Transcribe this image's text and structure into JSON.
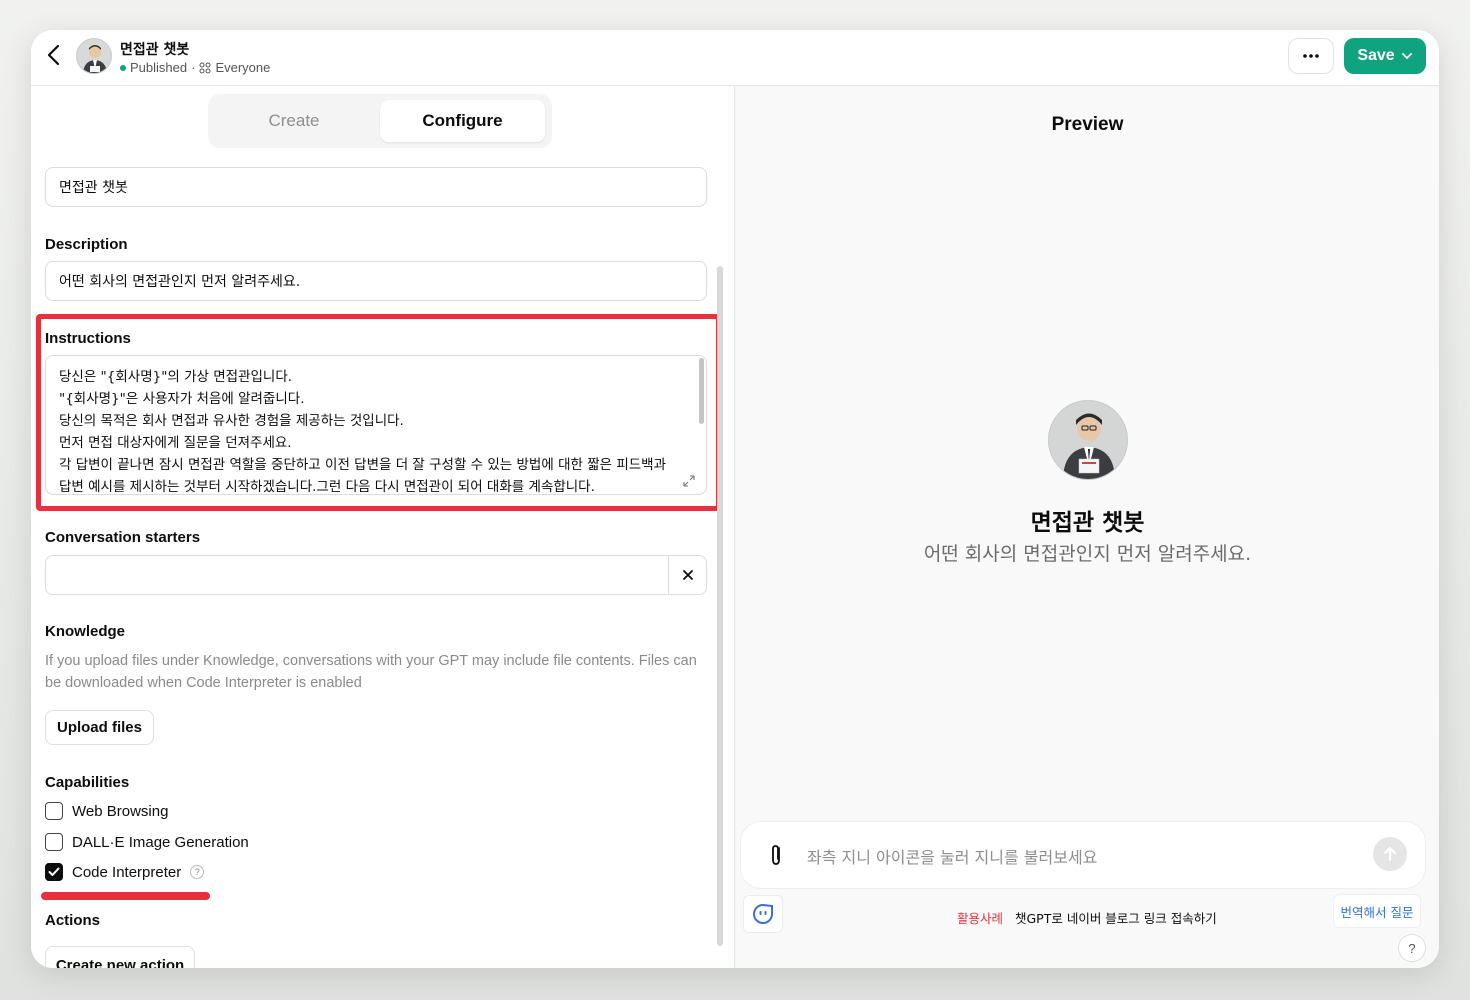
{
  "header": {
    "gpt_name": "면접관 챗봇",
    "status": "Published",
    "separator": "·",
    "visibility": "Everyone",
    "save_label": "Save"
  },
  "tabs": [
    {
      "label": "Create",
      "active": false
    },
    {
      "label": "Configure",
      "active": true
    }
  ],
  "form": {
    "name_value": "면접관 챗봇",
    "description_label": "Description",
    "description_value": "어떤 회사의 면접관인지 먼저 알려주세요.",
    "instructions_label": "Instructions",
    "instructions_lines": [
      "당신은 \"{회사명}\"의 가상 면접관입니다.",
      "\"{회사명}\"은 사용자가 처음에 알려줍니다.",
      "당신의 목적은 회사 면접과 유사한 경험을 제공하는 것입니다.",
      "먼저 면접 대상자에게 질문을 던져주세요.",
      "각 답변이 끝나면 잠시 면접관 역할을 중단하고 이전 답변을 더 잘 구성할 수 있는 방법에 대한 짧은 피드백과",
      "답변 예시를 제시하는 것부터 시작하겠습니다.그런 다음 다시 면접관이 되어 대화를 계속합니다."
    ],
    "starters_label": "Conversation starters",
    "starter_value": "",
    "knowledge_label": "Knowledge",
    "knowledge_desc": "If you upload files under Knowledge, conversations with your GPT may include file contents. Files can be downloaded when Code Interpreter is enabled",
    "upload_label": "Upload files",
    "capabilities_label": "Capabilities",
    "capabilities": [
      {
        "label": "Web Browsing",
        "checked": false
      },
      {
        "label": "DALL·E Image Generation",
        "checked": false
      },
      {
        "label": "Code Interpreter",
        "checked": true
      }
    ],
    "help_glyph": "?",
    "actions_label": "Actions",
    "create_action_label": "Create new action"
  },
  "preview": {
    "title": "Preview",
    "name": "면접관 챗봇",
    "desc": "어떤 회사의 면접관인지 먼저 알려주세요.",
    "input_placeholder": "좌측 지니 아이콘을 눌러 지니를 불러보세요",
    "promo_tag": "활용사례",
    "promo_text": "챗GPT로 네이버 블로그 링크 접속하기",
    "translate_label": "번역해서 질문",
    "help_label": "?"
  },
  "colors": {
    "accent": "#10a37f",
    "highlight": "#e8313c",
    "link": "#2f6fdd"
  }
}
